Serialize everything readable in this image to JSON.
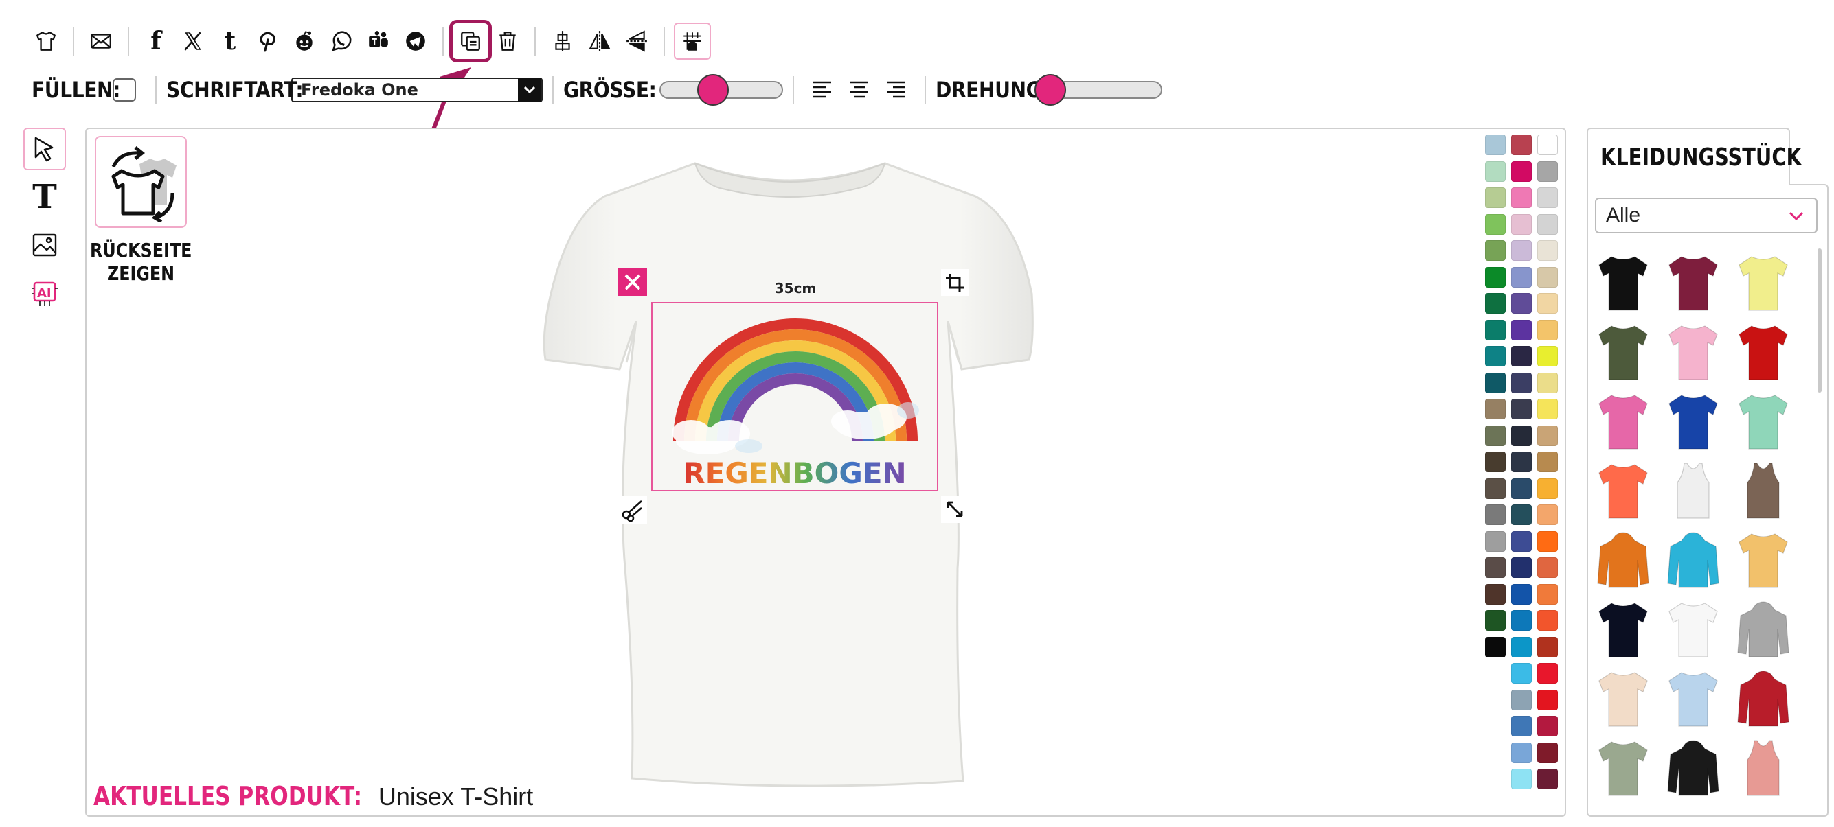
{
  "toolbar_icons": [
    "tshirt-icon",
    "mail-icon",
    "facebook-icon",
    "x-icon",
    "tumblr-icon",
    "pinterest-icon",
    "reddit-icon",
    "whatsapp-icon",
    "teams-icon",
    "telegram-icon",
    "duplicate-icon",
    "trash-icon",
    "align-center-icon",
    "flip-horizontal-icon",
    "flip-vertical-icon",
    "grid-snap-icon"
  ],
  "options": {
    "fill_label": "FÜLLEN:",
    "font_label": "SCHRIFTART:",
    "font_value": "Fredoka One",
    "size_label": "GRÖSSE:",
    "size_level": 0.44,
    "rotation_label": "DREHUNG:",
    "rotation_level": 0.0
  },
  "back_side": {
    "label_line1": "RÜCKSEITE",
    "label_line2": "ZEIGEN"
  },
  "design": {
    "width_label": "35cm",
    "text": "REGENBOGEN"
  },
  "current_product": {
    "label": "AKTUELLES PRODUKT:",
    "value": "Unisex T-Shirt"
  },
  "garment_panel": {
    "title": "KLEIDUNGSSTÜCK",
    "filter_value": "Alle",
    "products": [
      {
        "name": "black-tshirt",
        "color": "#111111",
        "type": "tee"
      },
      {
        "name": "maroon-tshirt",
        "color": "#7e1e3d",
        "type": "tee"
      },
      {
        "name": "yellow-tshirt",
        "color": "#f1ee8c",
        "type": "tee"
      },
      {
        "name": "olive-tshirt",
        "color": "#4d5a3b",
        "type": "tee"
      },
      {
        "name": "pink-tshirt",
        "color": "#f5b3cd",
        "type": "tee"
      },
      {
        "name": "red-tshirt",
        "color": "#c91212",
        "type": "tee"
      },
      {
        "name": "magenta-tshirt",
        "color": "#e667a8",
        "type": "tee"
      },
      {
        "name": "royal-tshirt",
        "color": "#1744a8",
        "type": "tee"
      },
      {
        "name": "mint-tshirt",
        "color": "#8fd6b9",
        "type": "tee"
      },
      {
        "name": "coral-tshirt",
        "color": "#ff6a4a",
        "type": "tee"
      },
      {
        "name": "white-tank",
        "color": "#efefef",
        "type": "tank"
      },
      {
        "name": "brown-tank",
        "color": "#7b6455",
        "type": "tank"
      },
      {
        "name": "orange-hoodie",
        "color": "#e2741c",
        "type": "hoodie"
      },
      {
        "name": "turquoise-hoodie",
        "color": "#2bb3d8",
        "type": "hoodie"
      },
      {
        "name": "tiedye-tshirt",
        "color": "#f2c16b",
        "type": "tee"
      },
      {
        "name": "navy-tshirt",
        "color": "#0b0f22",
        "type": "tee"
      },
      {
        "name": "raglan-tshirt",
        "color": "#f7f7f7",
        "type": "tee"
      },
      {
        "name": "grey-hoodie",
        "color": "#a7a7a7",
        "type": "hoodie"
      },
      {
        "name": "cream-tshirt",
        "color": "#f2dcc8",
        "type": "tee"
      },
      {
        "name": "lightblue-tshirt",
        "color": "#b9d4ec",
        "type": "tee"
      },
      {
        "name": "red-varsity-jacket",
        "color": "#b81d2a",
        "type": "hoodie"
      },
      {
        "name": "sage-longsleeve",
        "color": "#9aa88f",
        "type": "tee"
      },
      {
        "name": "black-orange-hoodie",
        "color": "#1a1a1a",
        "type": "hoodie"
      },
      {
        "name": "rose-tank",
        "color": "#e79a94",
        "type": "tank"
      }
    ]
  },
  "swatch_columns": [
    [
      "#a9c7d8",
      "#b2dcc0",
      "#b6cc93",
      "#7fc35c",
      "#77a356",
      "#0b8a28",
      "#0e7040",
      "#0b7d6a",
      "#0e8286",
      "#0f5966",
      "#968063",
      "#6c7457",
      "#483c2e",
      "#5b5046",
      "#7a7a7a",
      "#9e9e9e",
      "#5a4c48",
      "#4f342a",
      "#1e5523",
      "#0a0a0a"
    ],
    [
      "#b84150",
      "#d20a63",
      "#ef79b4",
      "#e6bfd2",
      "#cbbad8",
      "#8795cc",
      "#604c98",
      "#5c33a0",
      "#2a2744",
      "#3b3e64",
      "#3a3c4f",
      "#252a38",
      "#2c3546",
      "#2a4b6a",
      "#244f5c",
      "#3d4c94",
      "#22306d",
      "#1354a9",
      "#0d78b9",
      "#0c96c8",
      "#3bbbe7",
      "#8da3b3",
      "#3f77b6",
      "#79a6d8",
      "#8ee2f3"
    ],
    [
      "#ffffff",
      "#a6a6a6",
      "#d6d6d6",
      "#d3d3d3",
      "#e9e3d6",
      "#d7c8a8",
      "#f1d6a3",
      "#f3c46a",
      "#e8ee2f",
      "#ebdd8a",
      "#f5e45a",
      "#c9a476",
      "#b78a4f",
      "#f7b031",
      "#f3a66b",
      "#ff6b13",
      "#e06640",
      "#f07a3a",
      "#f2552c",
      "#b0321e",
      "#e8172c",
      "#e3151f",
      "#b3193f",
      "#7f1b2a",
      "#6b1c34"
    ]
  ]
}
